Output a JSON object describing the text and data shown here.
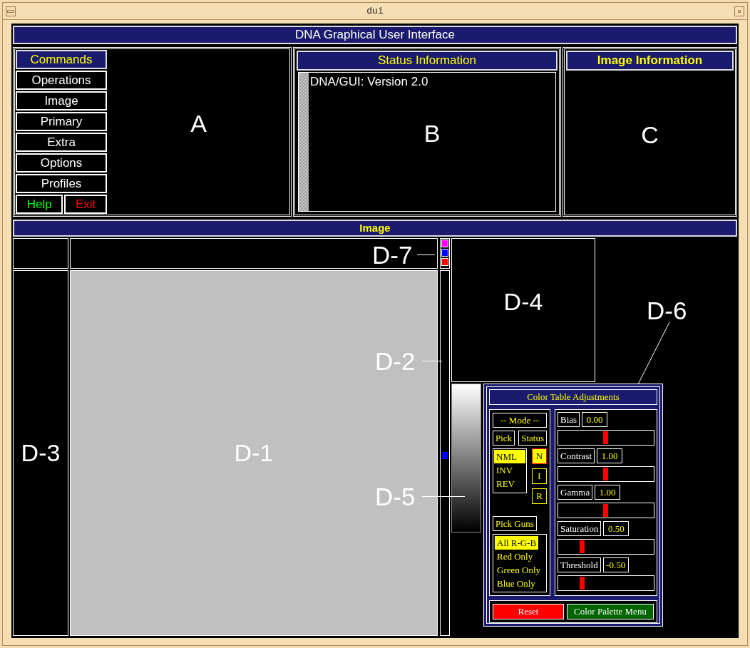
{
  "window": {
    "title": "dui"
  },
  "app_title": "DNA Graphical User Interface",
  "commands": {
    "title": "Commands",
    "items": [
      {
        "label": "Operations"
      },
      {
        "label": "Image"
      },
      {
        "label": "Primary"
      },
      {
        "label": "Extra"
      },
      {
        "label": "Options"
      },
      {
        "label": "Profiles"
      }
    ],
    "help": "Help",
    "exit": "Exit"
  },
  "panel_a": {
    "label": "A"
  },
  "status": {
    "title": "Status Information",
    "lines": [
      "DNA/GUI: Version 2.0"
    ],
    "label": "B"
  },
  "image_info": {
    "title": "Image Information",
    "label": "C"
  },
  "image": {
    "title": "Image",
    "d1": "D-1",
    "d2": "D-2",
    "d3": "D-3",
    "d4": "D-4",
    "d5": "D-5",
    "d6": "D-6",
    "d7": "D-7",
    "swatches": [
      {
        "color": "#ff00ff"
      },
      {
        "color": "#0000ff"
      },
      {
        "color": "#ff0000"
      }
    ]
  },
  "color_table": {
    "title": "Color Table Adjustments",
    "mode_title": "-- Mode --",
    "pick": "Pick",
    "status": "Status",
    "modes": [
      {
        "label": "NML",
        "selected": true
      },
      {
        "label": "INV",
        "selected": false
      },
      {
        "label": "REV",
        "selected": false
      }
    ],
    "mode_status": [
      {
        "label": "N",
        "selected": true
      },
      {
        "label": "I",
        "selected": false
      },
      {
        "label": "R",
        "selected": false
      }
    ],
    "pick_guns": "Pick Guns",
    "guns": [
      {
        "label": "All R-G-B",
        "selected": true
      },
      {
        "label": "Red Only",
        "selected": false
      },
      {
        "label": "Green Only",
        "selected": false
      },
      {
        "label": "Blue Only",
        "selected": false
      }
    ],
    "sliders": [
      {
        "label": "Bias",
        "value": "0.00",
        "level": 0.5
      },
      {
        "label": "Contrast",
        "value": "1.00",
        "level": 0.5
      },
      {
        "label": "Gamma",
        "value": "1.00",
        "level": 0.5
      },
      {
        "label": "Saturation",
        "value": "0.50",
        "level": 0.25
      },
      {
        "label": "Threshold",
        "value": "-0.50",
        "level": 0.25
      }
    ],
    "reset": "Reset",
    "palette": "Color Palette Menu"
  }
}
